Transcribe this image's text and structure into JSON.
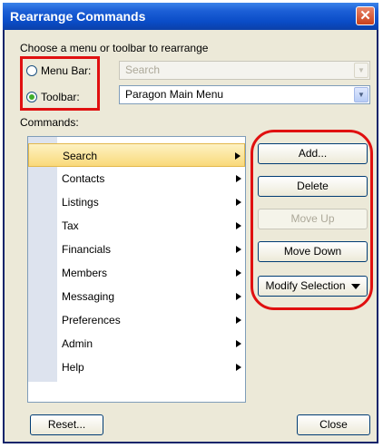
{
  "window": {
    "title": "Rearrange Commands",
    "close_glyph": "✕"
  },
  "chooser": {
    "label": "Choose a menu or toolbar to rearrange",
    "menu_bar": {
      "label": "Menu Bar:",
      "checked": false,
      "combo_value": "Search",
      "combo_enabled": false
    },
    "toolbar": {
      "label": "Toolbar:",
      "checked": true,
      "combo_value": "Paragon Main Menu",
      "combo_enabled": true
    },
    "combo_arrow_glyph": "▼"
  },
  "commands": {
    "label": "Commands:",
    "items": [
      {
        "label": "Search",
        "selected": true
      },
      {
        "label": "Contacts",
        "selected": false
      },
      {
        "label": "Listings",
        "selected": false
      },
      {
        "label": "Tax",
        "selected": false
      },
      {
        "label": "Financials",
        "selected": false
      },
      {
        "label": "Members",
        "selected": false
      },
      {
        "label": "Messaging",
        "selected": false
      },
      {
        "label": "Preferences",
        "selected": false
      },
      {
        "label": "Admin",
        "selected": false
      },
      {
        "label": "Help",
        "selected": false
      }
    ]
  },
  "actions": {
    "add": "Add...",
    "delete": "Delete",
    "move_up": "Move Up",
    "move_down": "Move Down",
    "modify_selection": "Modify Selection"
  },
  "footer": {
    "reset": "Reset...",
    "close": "Close"
  },
  "colors": {
    "highlight_box": "#e01010",
    "titlebar": "#0a4cc7",
    "selection": "#f9d97a"
  }
}
